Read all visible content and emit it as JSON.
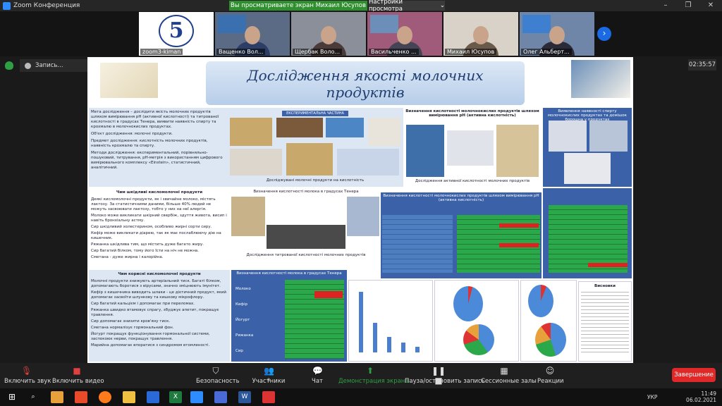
{
  "window": {
    "title": "Zoom Конференция",
    "share_banner": "Вы просматриваете экран Михаил Юсупов",
    "view_options": "Настройки просмотра",
    "controls": [
      "–",
      "❐",
      "✕"
    ]
  },
  "participants": [
    {
      "name": "zoom3-kiman",
      "kind": "logo",
      "logo_text": "5"
    },
    {
      "name": "Ващенко Вол...",
      "kind": "video"
    },
    {
      "name": "Щербак Воло...",
      "kind": "video"
    },
    {
      "name": "Васильченко ...",
      "kind": "video"
    },
    {
      "name": "Михаил Юсупов",
      "kind": "video"
    },
    {
      "name": "Олег Альберт...",
      "kind": "video"
    }
  ],
  "next_icon": "chevron-right-icon",
  "recording": {
    "label": "Запись...",
    "pause": "❚❚",
    "stop": "■"
  },
  "timer": "02:35:57",
  "slide": {
    "title": "Дослідження якості молочних продуктів",
    "intro_lines": [
      "Мета дослідження – дослідити якість молочних продуктів шляхом вимірювання pH (активної кислотності) та титрованої кислотності в градусах Тенера, виявити наявність спирту та крохмалю в молочнокислих продуктах.",
      "Об'єкт дослідження: молочні продукти.",
      "Предмет дослідження: кислотність молочних продуктів, наявність крохмалю та спирту.",
      "Методи дослідження: експериментальний, порівняльно-пошуковий, титрування, pH-метрія з використанням цифрового вимірювального комплексу «Einstein», статистичний, аналітичний."
    ],
    "experimental_header": "ЕКСПЕРИМЕНТАЛЬНА ЧАСТИНА",
    "experimental_caption": "Досліджувані молочні продукти на кислотність",
    "ph_title": "Визначення кислотності молочнокислих продуктів шляхом вимірювання pH (активна кислотність)",
    "ph_caption": "Дослідження активної кислотності молочних продуктів",
    "starch_title": "Виявлення наявності спирту молочнокислих продуктах та домішок борошна у продуктах",
    "harm_title": "Чим шкідливі кисломолочні продукти",
    "harm_lines": [
      "Деякі кисломолочні продукти, як і звичайне молоко, містять лактозу. За статистичними даними, більше 40% людей не можуть засвоювати лактозу, тобто у них на неї алергія.",
      "Молоко може викликати шкірний свербіж, здуття живота, висип і навіть бронхіальну астму.",
      "Сир шкідливий холестерином, особливо жирні сорти сиру.",
      "Кефір може викликати діарею, так як має послаблюючу дію на кишечник.",
      "Ряжанка шкідлива тим, що містить дуже багато жиру.",
      "Сир багатий білком, тому його їсти на ніч не можна.",
      "Сметана - дуже жирна і калорійна."
    ],
    "titration_title": "Визначення кислотності молока в градусах Тенера",
    "titration_caption": "Дослідження титрованої кислотності молочних продуктів",
    "ph_table_title": "Визначення кислотності молочнокислих продуктів шляхом вимірювання pH (активна кислотність)",
    "benefit_title": "Чим корисні кисломолочні продукти",
    "benefit_lines": [
      "Молочні продукти знижують артеріальний тиск. Багаті білком, допомагають боротися з вірусами, значно зміцнюють імунітет.",
      "Кефір з кишечника виводить шлаки - це дієтичний продукт, який допомагає засвоїти шлункову та кишкову мікрофлору.",
      "Сир багатий кальцієм і допомагає при переломах.",
      "Ряжанка швидко втамовує спрагу, збуджує апетит, покращує травлення.",
      "Сир допомагає знизити кров'яну тиск.",
      "Сметана нормалізує гормональний фон.",
      "Йогурт покращує функціонування гормональної системи, заспокоює нерви, покращує травлення.",
      "Марийна допомагає впоратися з синдромом втомленості."
    ],
    "table_header": "Визначення кислотності молока в градусах Тенера",
    "table_rows": [
      "Молоко",
      "Кефір",
      "Йогурт",
      "Ряжанка",
      "Сир"
    ],
    "conclusions_title": "Висновки"
  },
  "toolbar": {
    "mute": "Включить звук",
    "video": "Включить видео",
    "security": "Безопасность",
    "participants": "Участники",
    "participants_count": "8",
    "chat": "Чат",
    "share": "Демонстрация экрана",
    "pause_rec": "Пауза/остановить запись",
    "rooms": "Сессионные залы",
    "reactions": "Реакции",
    "end": "Завершение"
  },
  "taskbar": {
    "lang": "УКР",
    "time": "11:49",
    "date": "06.02.2021"
  }
}
